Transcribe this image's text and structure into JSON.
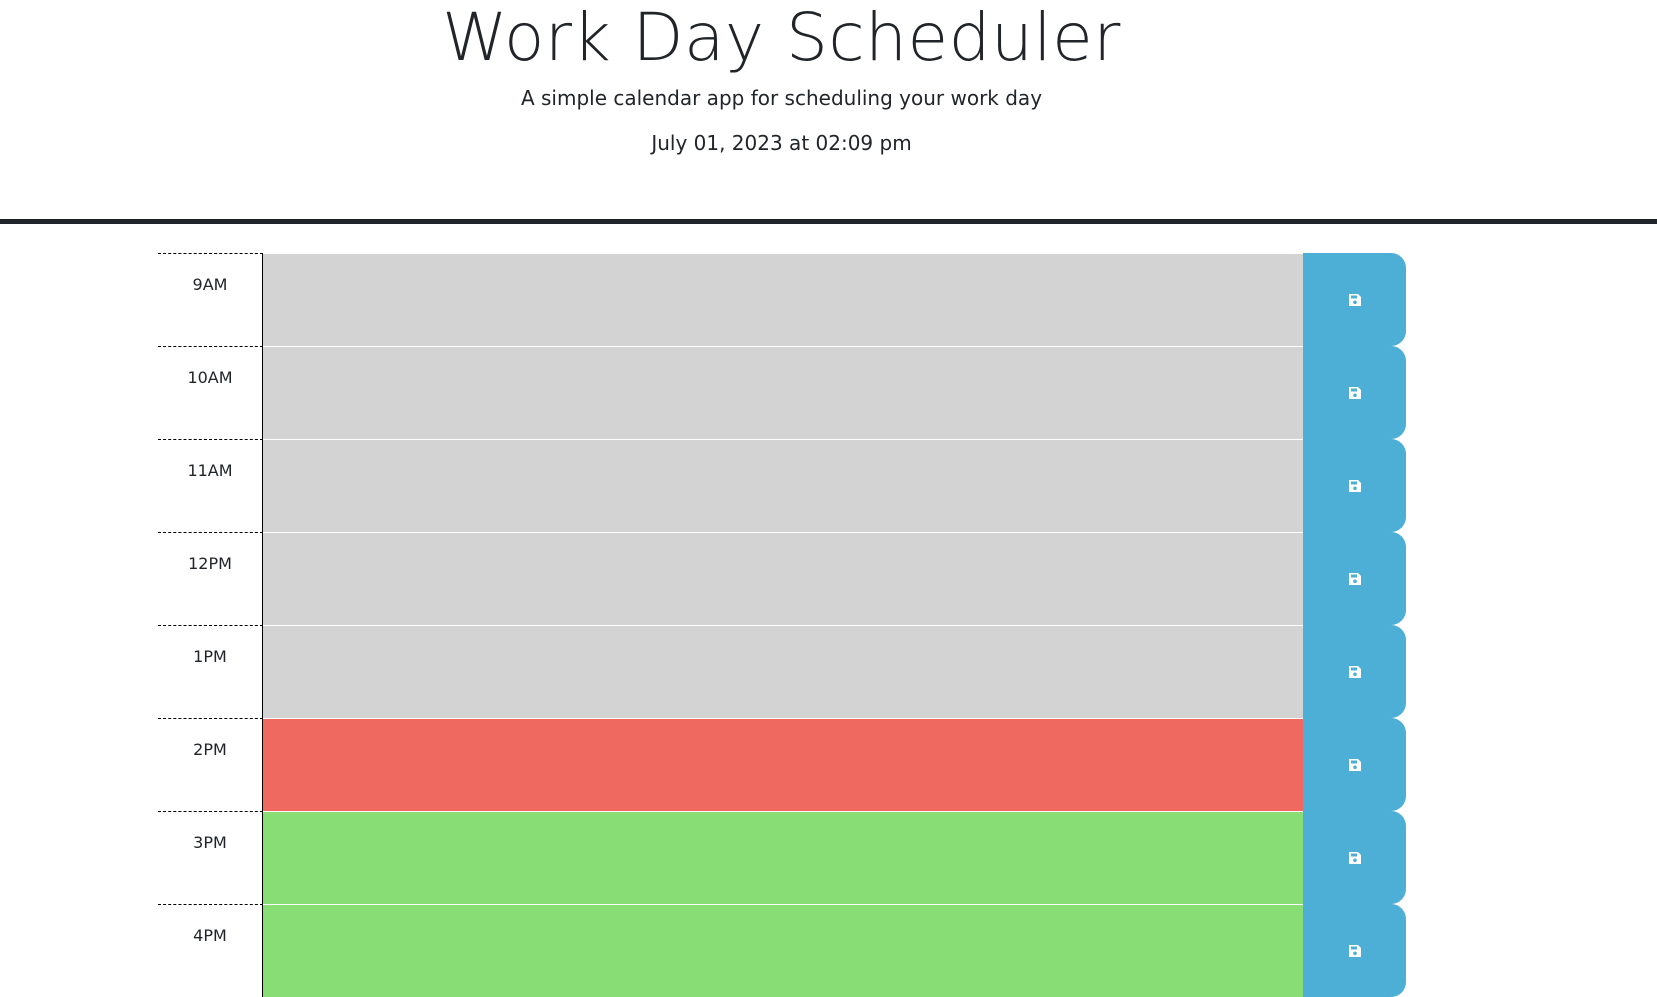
{
  "header": {
    "title": "Work Day Scheduler",
    "subtitle": "A simple calendar app for scheduling your work day",
    "current_day": "July 01, 2023 at 02:09 pm"
  },
  "colors": {
    "past": "#d3d3d3",
    "present": "#ef6961",
    "future": "#88dd74",
    "save_button": "#4dafd6",
    "divider": "#212529"
  },
  "time_blocks": [
    {
      "hour": "9AM",
      "status": "past",
      "description": "",
      "save_icon": "save-icon"
    },
    {
      "hour": "10AM",
      "status": "past",
      "description": "",
      "save_icon": "save-icon"
    },
    {
      "hour": "11AM",
      "status": "past",
      "description": "",
      "save_icon": "save-icon"
    },
    {
      "hour": "12PM",
      "status": "past",
      "description": "",
      "save_icon": "save-icon"
    },
    {
      "hour": "1PM",
      "status": "past",
      "description": "",
      "save_icon": "save-icon"
    },
    {
      "hour": "2PM",
      "status": "present",
      "description": "",
      "save_icon": "save-icon"
    },
    {
      "hour": "3PM",
      "status": "future",
      "description": "",
      "save_icon": "save-icon"
    },
    {
      "hour": "4PM",
      "status": "future",
      "description": "",
      "save_icon": "save-icon"
    }
  ]
}
